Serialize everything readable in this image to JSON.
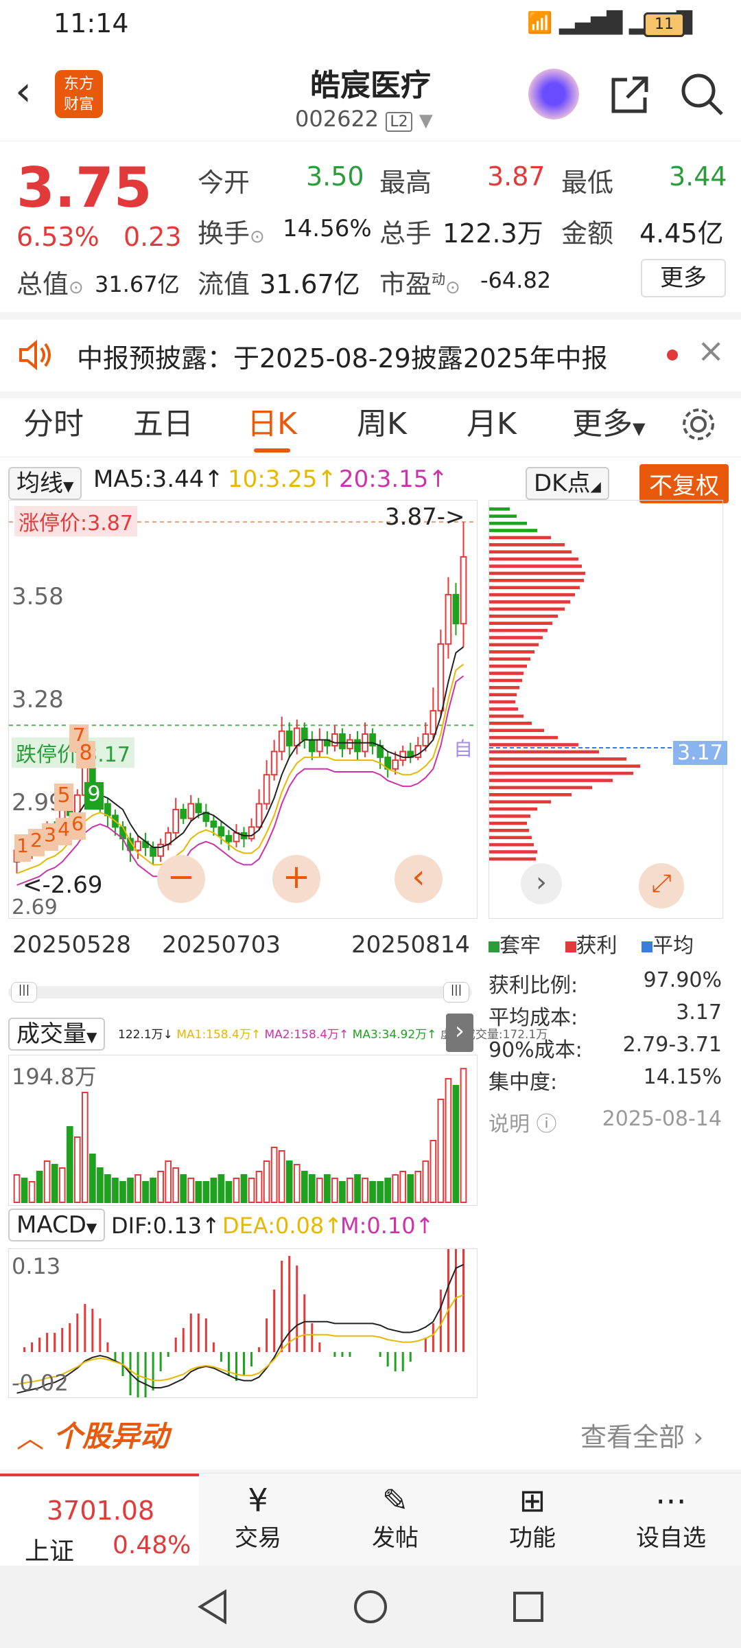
{
  "status_bar": {
    "time": "11:14",
    "battery": "11"
  },
  "header": {
    "title": "皓宸医疗",
    "code": "002622",
    "level": "L2",
    "logo_line1": "东方",
    "logo_line2": "财富"
  },
  "quote": {
    "price": "3.75",
    "pct": "6.53%",
    "change": "0.23",
    "open_label": "今开",
    "open": "3.50",
    "high_label": "最高",
    "high": "3.87",
    "low_label": "最低",
    "low": "3.44",
    "turnover_label": "换手",
    "turnover": "14.56%",
    "volume_label": "总手",
    "volume": "122.3万",
    "amount_label": "金额",
    "amount": "4.45亿",
    "mktcap_label": "总值",
    "mktcap": "31.67亿",
    "float_label": "流值",
    "float": "31.67亿",
    "pe_label": "市盈",
    "pe_sup": "动",
    "pe": "-64.82",
    "more_button": "更多"
  },
  "notice": {
    "text": "中报预披露：于2025-08-29披露2025年中报"
  },
  "tabs": [
    "分时",
    "五日",
    "日K",
    "周K",
    "月K",
    "更多"
  ],
  "chart_toolbar": {
    "ma_select": "均线",
    "ma5": "MA5:3.44↑",
    "ma10": "10:3.25↑",
    "ma20": "20:3.15↑",
    "dk": "DK点",
    "fq": "不复权"
  },
  "colors": {
    "up": "#e23a3a",
    "down": "#1fa21f",
    "accent": "#e8590c",
    "ma5": "#222222",
    "ma10": "#e6b800",
    "ma20": "#cc33aa"
  },
  "price_chart": {
    "limit_up": "涨停价:3.87",
    "limit_up_line": "3.87",
    "high_marker": "3.87->",
    "limit_down": "跌停价:3.17",
    "y_ticks": [
      "3.58",
      "3.28",
      "2.99",
      "2.69"
    ],
    "low_marker": "<-2.69",
    "x_dates": [
      "20250528",
      "20250703",
      "20250814"
    ],
    "signals": [
      "7",
      "8",
      "5",
      "9",
      "1",
      "2",
      "3",
      "4",
      "6"
    ],
    "self_tag": "自"
  },
  "chip_profile": {
    "cost_marker": "3.17",
    "legend": [
      "套牢",
      "获利",
      "平均"
    ],
    "rows": [
      {
        "label": "获利比例:",
        "value": "97.90%"
      },
      {
        "label": "平均成本:",
        "value": "3.17"
      },
      {
        "label": "90%成本:",
        "value": "2.79-3.71"
      },
      {
        "label": "集中度:",
        "value": "14.15%"
      }
    ],
    "note_label": "说明",
    "note_date": "2025-08-14"
  },
  "volume": {
    "select": "成交量",
    "vol": "122.1万↓",
    "ma1": "MA1:158.4万↑",
    "ma2": "MA2:158.4万↑",
    "ma3": "MA3:34.92万↑",
    "virtual": "虚拟成交量:172.1万",
    "max_label": "194.8万"
  },
  "macd": {
    "select": "MACD",
    "dif": "DIF:0.13↑",
    "dea": "DEA:0.08↑",
    "m": "M:0.10↑",
    "top": "0.13",
    "bottom": "-0.02"
  },
  "movement": {
    "title": "个股异动",
    "view_all": "查看全部"
  },
  "bottom_nav": {
    "index_value": "3701.08",
    "index_name": "上证",
    "index_pct": "0.48%",
    "trade": "交易",
    "post": "发帖",
    "func": "功能",
    "watch": "设自选"
  },
  "chart_data": {
    "type": "candlestick",
    "x_labels": [
      "20250528",
      "20250703",
      "20250814"
    ],
    "y_ticks": [
      2.69,
      2.99,
      3.28,
      3.58
    ],
    "ylim": [
      2.62,
      3.92
    ],
    "candles": [
      [
        2.7,
        2.74,
        2.66,
        2.76
      ],
      [
        2.74,
        2.73,
        2.7,
        2.77
      ],
      [
        2.73,
        2.78,
        2.71,
        2.8
      ],
      [
        2.78,
        2.76,
        2.73,
        2.8
      ],
      [
        2.76,
        2.82,
        2.75,
        2.84
      ],
      [
        2.82,
        2.8,
        2.77,
        2.84
      ],
      [
        2.8,
        2.88,
        2.79,
        2.9
      ],
      [
        2.88,
        2.86,
        2.83,
        2.9
      ],
      [
        2.86,
        2.93,
        2.85,
        2.95
      ],
      [
        2.93,
        3.05,
        2.92,
        3.1
      ],
      [
        3.05,
        2.95,
        2.92,
        3.07
      ],
      [
        2.95,
        2.9,
        2.87,
        2.97
      ],
      [
        2.9,
        2.86,
        2.82,
        2.92
      ],
      [
        2.86,
        2.82,
        2.79,
        2.88
      ],
      [
        2.82,
        2.78,
        2.74,
        2.84
      ],
      [
        2.78,
        2.74,
        2.7,
        2.8
      ],
      [
        2.74,
        2.77,
        2.71,
        2.79
      ],
      [
        2.77,
        2.75,
        2.72,
        2.8
      ],
      [
        2.75,
        2.72,
        2.69,
        2.77
      ],
      [
        2.72,
        2.76,
        2.7,
        2.78
      ],
      [
        2.76,
        2.8,
        2.74,
        2.82
      ],
      [
        2.8,
        2.88,
        2.78,
        2.92
      ],
      [
        2.88,
        2.85,
        2.83,
        2.9
      ],
      [
        2.85,
        2.9,
        2.84,
        2.93
      ],
      [
        2.9,
        2.87,
        2.85,
        2.92
      ],
      [
        2.87,
        2.84,
        2.82,
        2.9
      ],
      [
        2.84,
        2.82,
        2.79,
        2.86
      ],
      [
        2.82,
        2.79,
        2.76,
        2.84
      ],
      [
        2.79,
        2.77,
        2.74,
        2.81
      ],
      [
        2.77,
        2.8,
        2.75,
        2.83
      ],
      [
        2.8,
        2.78,
        2.75,
        2.82
      ],
      [
        2.78,
        2.82,
        2.77,
        2.85
      ],
      [
        2.82,
        2.9,
        2.81,
        2.95
      ],
      [
        2.9,
        3.0,
        2.88,
        3.05
      ],
      [
        3.0,
        3.08,
        2.98,
        3.12
      ],
      [
        3.08,
        3.15,
        3.05,
        3.2
      ],
      [
        3.15,
        3.1,
        3.06,
        3.18
      ],
      [
        3.1,
        3.16,
        3.07,
        3.19
      ],
      [
        3.16,
        3.12,
        3.09,
        3.18
      ],
      [
        3.12,
        3.08,
        3.05,
        3.15
      ],
      [
        3.08,
        3.12,
        3.06,
        3.16
      ],
      [
        3.12,
        3.1,
        3.07,
        3.15
      ],
      [
        3.1,
        3.14,
        3.08,
        3.17
      ],
      [
        3.14,
        3.09,
        3.06,
        3.16
      ],
      [
        3.09,
        3.12,
        3.07,
        3.14
      ],
      [
        3.12,
        3.08,
        3.05,
        3.15
      ],
      [
        3.08,
        3.14,
        3.06,
        3.18
      ],
      [
        3.14,
        3.1,
        3.07,
        3.16
      ],
      [
        3.1,
        3.06,
        3.02,
        3.12
      ],
      [
        3.06,
        3.02,
        2.99,
        3.08
      ],
      [
        3.02,
        3.05,
        3.0,
        3.08
      ],
      [
        3.05,
        3.08,
        3.03,
        3.1
      ],
      [
        3.08,
        3.06,
        3.04,
        3.11
      ],
      [
        3.06,
        3.1,
        3.05,
        3.13
      ],
      [
        3.1,
        3.14,
        3.08,
        3.18
      ],
      [
        3.14,
        3.22,
        3.12,
        3.3
      ],
      [
        3.22,
        3.45,
        3.2,
        3.5
      ],
      [
        3.45,
        3.62,
        3.4,
        3.68
      ],
      [
        3.62,
        3.52,
        3.48,
        3.66
      ],
      [
        3.52,
        3.75,
        3.44,
        3.87
      ]
    ],
    "volumes": [
      40,
      35,
      30,
      45,
      60,
      55,
      50,
      110,
      95,
      160,
      70,
      50,
      40,
      35,
      30,
      35,
      40,
      30,
      35,
      45,
      60,
      50,
      40,
      35,
      30,
      30,
      35,
      40,
      30,
      35,
      40,
      35,
      45,
      60,
      80,
      75,
      60,
      55,
      45,
      40,
      35,
      40,
      35,
      30,
      35,
      40,
      35,
      30,
      30,
      35,
      40,
      45,
      40,
      45,
      60,
      90,
      150,
      180,
      170,
      194.8
    ],
    "ma5": [
      2.72,
      2.73,
      2.74,
      2.75,
      2.77,
      2.78,
      2.8,
      2.83,
      2.86,
      2.9,
      2.92,
      2.93,
      2.92,
      2.9,
      2.88,
      2.83,
      2.79,
      2.77,
      2.75,
      2.75,
      2.76,
      2.78,
      2.8,
      2.84,
      2.86,
      2.87,
      2.86,
      2.84,
      2.82,
      2.8,
      2.79,
      2.79,
      2.81,
      2.86,
      2.92,
      3.0,
      3.06,
      3.1,
      3.12,
      3.12,
      3.12,
      3.12,
      3.11,
      3.11,
      3.11,
      3.11,
      3.11,
      3.11,
      3.1,
      3.08,
      3.07,
      3.06,
      3.06,
      3.07,
      3.09,
      3.12,
      3.2,
      3.32,
      3.42,
      3.44
    ]
  }
}
